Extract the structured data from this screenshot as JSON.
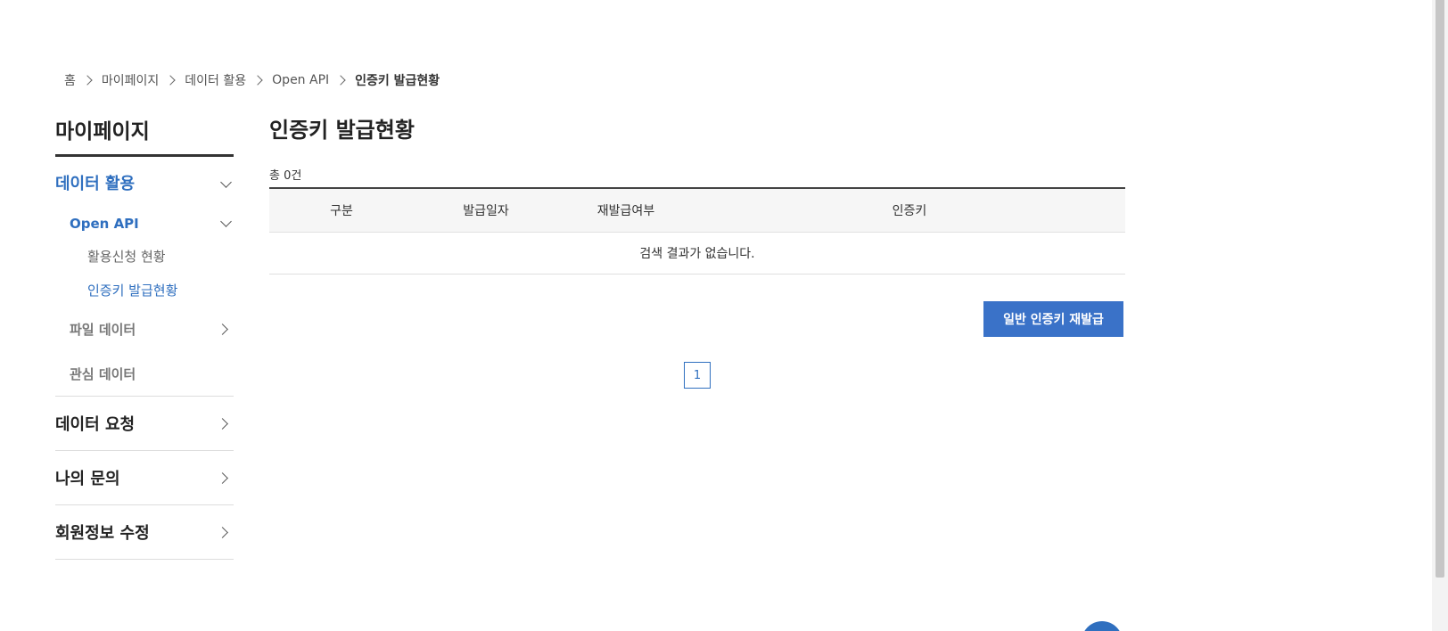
{
  "breadcrumb": {
    "items": [
      "홈",
      "마이페이지",
      "데이터 활용",
      "Open API",
      "인증키 발급현황"
    ]
  },
  "sidebar": {
    "title": "마이페이지",
    "data_use": {
      "label": "데이터 활용",
      "open_api": {
        "label": "Open API",
        "leaves": [
          "활용신청 현황",
          "인증키 발급현황"
        ]
      },
      "file_data": "파일 데이터",
      "interest_data": "관심 데이터"
    },
    "main_items": [
      "데이터 요청",
      "나의 문의",
      "회원정보 수정"
    ]
  },
  "main": {
    "title": "인증키 발급현황",
    "count": "총 0건",
    "table": {
      "headers": [
        "구분",
        "발급일자",
        "재발급여부",
        "인증키"
      ],
      "empty_message": "검색 결과가 없습니다."
    },
    "reissue_button": "일반 인증키 재발급",
    "pagination": {
      "current": "1"
    }
  },
  "colors": {
    "accent": "#2f6fbf",
    "button": "#3a72c8",
    "header_bg": "#f6f6f6"
  }
}
